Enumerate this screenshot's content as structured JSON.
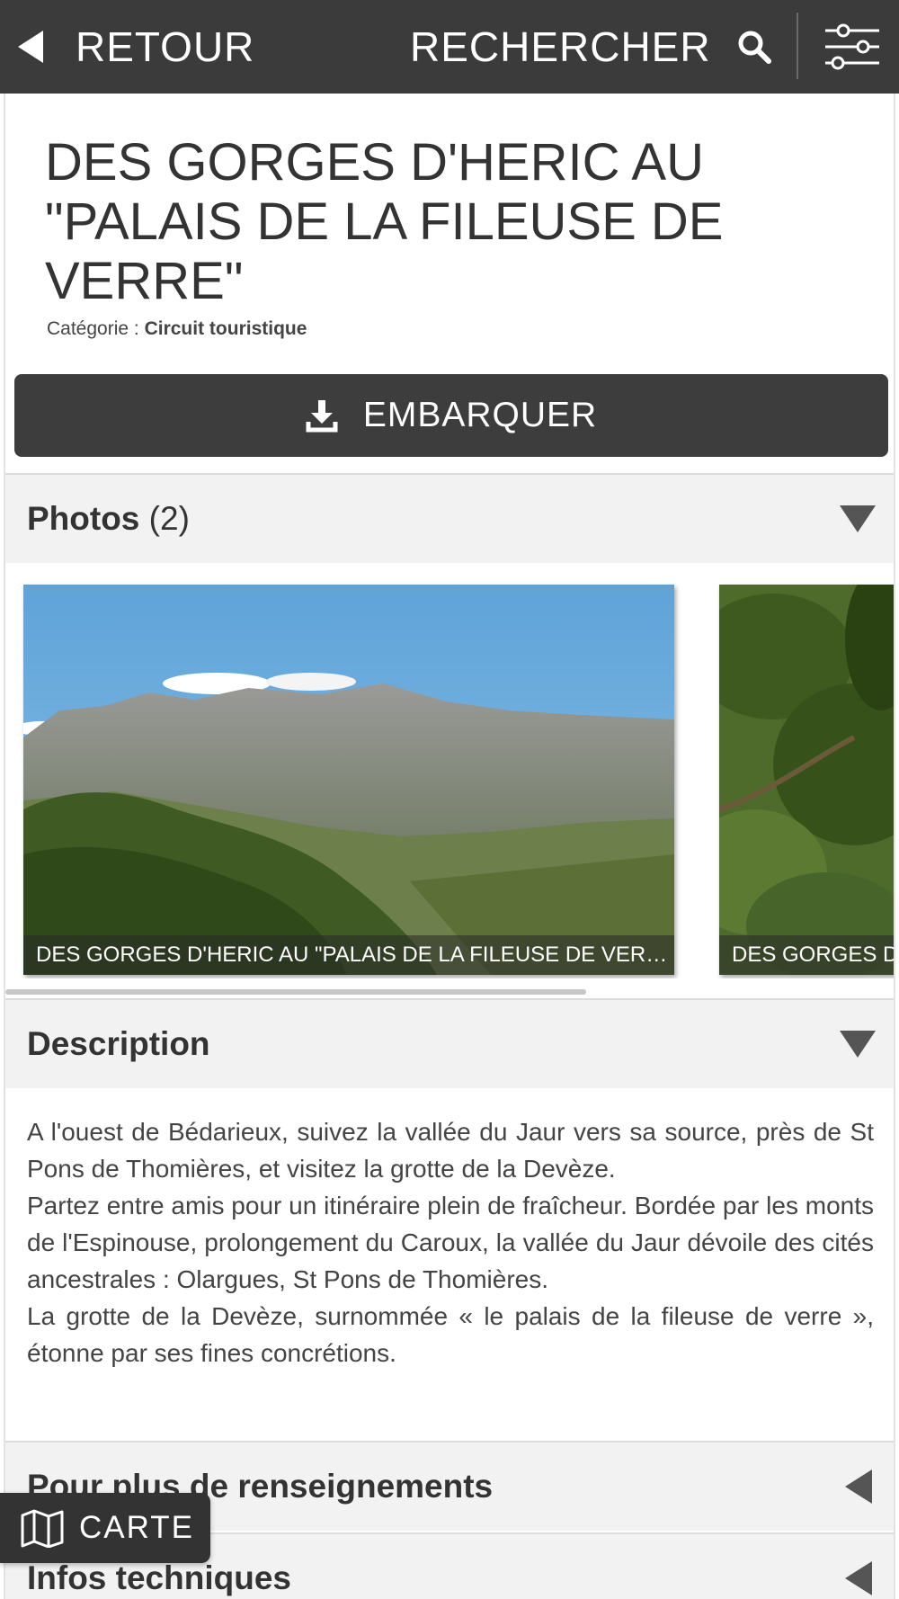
{
  "topbar": {
    "back_label": "RETOUR",
    "search_label": "RECHERCHER",
    "icons": [
      "back-arrow-icon",
      "search-icon",
      "filters-icon"
    ]
  },
  "item": {
    "title": "DES GORGES D'HERIC AU \"PALAIS DE LA FILEUSE DE VERRE\"",
    "category_label": "Catégorie :",
    "category_value": "Circuit touristique"
  },
  "embark": {
    "label": "EMBARQUER",
    "icon": "download-icon"
  },
  "photos_section": {
    "label": "Photos",
    "count": "(2)",
    "items": [
      {
        "caption": "DES GORGES D'HERIC AU \"PALAIS DE LA FILEUSE DE VERRE\""
      },
      {
        "caption": "DES GORGES D'HERIC AU \"PALAIS DE LA FILEUSE DE VERRE\""
      }
    ]
  },
  "description_section": {
    "label": "Description",
    "paragraphs": [
      "A l'ouest de Bédarieux, suivez la vallée du Jaur vers sa source, près de St Pons de Thomières, et visitez la grotte de la Devèze.",
      "Partez entre amis pour un itinéraire plein de fraîcheur. Bordée par les monts de l'Espinouse, prolongement du Caroux, la vallée du Jaur dévoile des cités ancestrales : Olargues, St Pons de Thomières.",
      "La grotte de la Devèze, surnommée « le palais de la fileuse de verre », étonne par ses fines concrétions."
    ]
  },
  "more_info_section": {
    "label": "Pour plus de renseignements"
  },
  "tech_section": {
    "label": "Infos techniques"
  },
  "map_button": {
    "label": "CARTE",
    "icon": "map-icon"
  },
  "colors": {
    "topbar_bg": "#3b3b3b",
    "button_bg": "#3d3d3d",
    "section_bg": "#f2f2f2",
    "text": "#333333"
  }
}
